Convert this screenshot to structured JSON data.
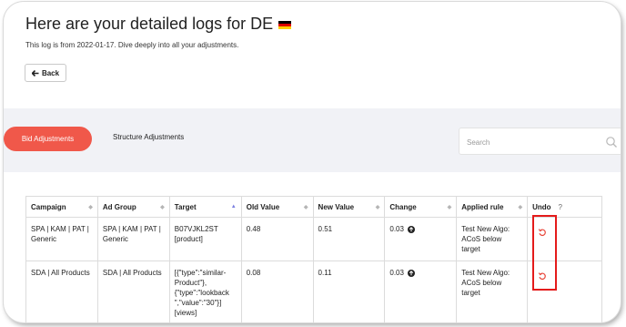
{
  "header": {
    "title": "Here are your detailed logs for DE",
    "subtitle": "This log is from 2022-01-17. Dive deeply into all your adjustments.",
    "flag_colors": [
      "#000000",
      "#dd0000",
      "#ffce00"
    ]
  },
  "back_button": {
    "label": "Back",
    "icon": "arrow-left-icon"
  },
  "tabs": [
    {
      "label": "Bid Adjustments",
      "active": true
    },
    {
      "label": "Structure Adjustments",
      "active": false
    }
  ],
  "search": {
    "placeholder": "Search",
    "value": ""
  },
  "table": {
    "columns": [
      "Campaign",
      "Ad Group",
      "Target",
      "Old Value",
      "New Value",
      "Change",
      "Applied rule",
      "Undo"
    ],
    "help_icon": "?",
    "sorted_column": "Target",
    "rows": [
      {
        "campaign": [
          "SPA | KAM | PAT |",
          "Generic"
        ],
        "ad_group": [
          "SPA | KAM | PAT |",
          "Generic"
        ],
        "target": [
          "B07VJKL2ST",
          "[product]"
        ],
        "old_value": "0.48",
        "new_value": "0.51",
        "change": "0.03",
        "applied_rule": [
          "Test New Algo:",
          "ACoS below",
          "target"
        ]
      },
      {
        "campaign": [
          "SDA | All Products"
        ],
        "ad_group": [
          "SDA | All Products"
        ],
        "target": [
          "[{\"type\":\"similar-",
          "Product\"},",
          "{\"type\":\"lookback",
          "\",\"value\":\"30\"}]",
          "[views]"
        ],
        "old_value": "0.08",
        "new_value": "0.11",
        "change": "0.03",
        "applied_rule": [
          "Test New Algo:",
          "ACoS below",
          "target"
        ]
      }
    ]
  },
  "colors": {
    "accent": "#f0584a",
    "band": "#f1f2f6",
    "sort_active": "#7b7fe0",
    "highlight": "#e41b1b"
  }
}
